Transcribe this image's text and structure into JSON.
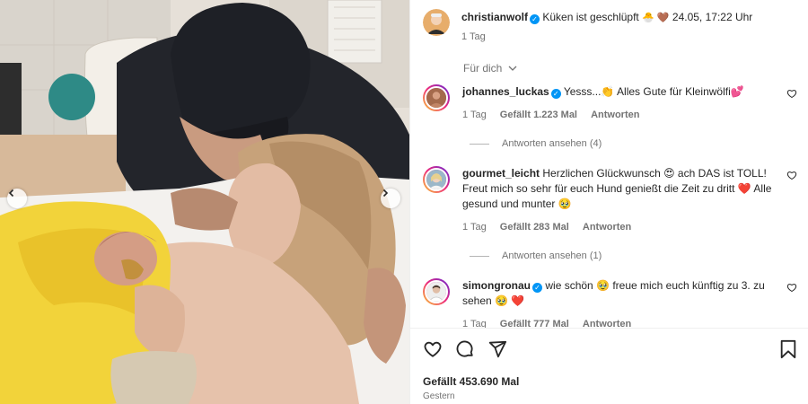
{
  "post": {
    "author": "christianwolf",
    "caption": "Küken ist geschlüpft",
    "caption_emojis": "🐣 🤎",
    "caption_date": "24.05, 17:22 Uhr",
    "age": "1 Tag"
  },
  "filter_label": "Für dich",
  "comments": [
    {
      "user": "johannes_luckas",
      "verified": true,
      "text": "Yesss...👏 Alles Gute für Kleinwölfi💕",
      "age": "1 Tag",
      "likes": "Gefällt 1.223 Mal",
      "reply": "Antworten",
      "view_replies": "Antworten ansehen (4)"
    },
    {
      "user": "gourmet_leicht",
      "verified": false,
      "text": "Herzlichen Glückwunsch 😍 ach DAS ist TOLL! Freut mich so sehr für euch Hund genießt die Zeit zu dritt ❤️ Alle gesund und munter 🥹",
      "age": "1 Tag",
      "likes": "Gefällt 283 Mal",
      "reply": "Antworten",
      "view_replies": "Antworten ansehen (1)"
    },
    {
      "user": "simongronau",
      "verified": true,
      "text": "wie schön 🥹 freue mich euch künftig zu 3. zu sehen 🥹 ❤️",
      "age": "1 Tag",
      "likes": "Gefällt 777 Mal",
      "reply": "Antworten"
    }
  ],
  "footer": {
    "likes": "Gefällt 453.690 Mal",
    "date": "Gestern"
  },
  "colors": {
    "accent": "#0095f6",
    "secondary_text": "#737373",
    "primary_text": "#262626"
  },
  "icons": [
    "heart-icon",
    "comment-icon",
    "share-icon",
    "bookmark-icon",
    "chevron-left-icon",
    "chevron-right-icon",
    "chevron-down-icon",
    "verified-icon"
  ]
}
